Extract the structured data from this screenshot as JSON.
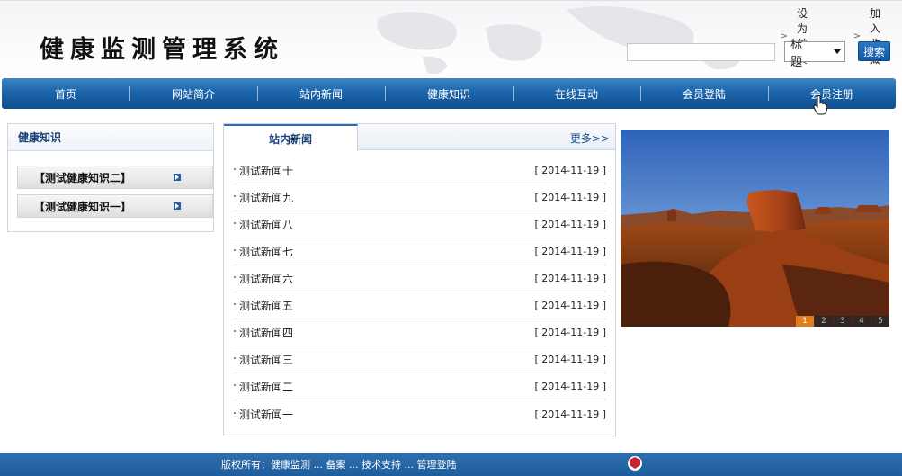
{
  "site": {
    "title": "健康监测管理系统"
  },
  "toplinks": [
    {
      "label": "设为首页"
    },
    {
      "label": "加入收藏"
    }
  ],
  "search": {
    "value": "",
    "select_value": "标 题",
    "button_label": "搜索"
  },
  "nav": [
    {
      "label": "首页"
    },
    {
      "label": "网站简介"
    },
    {
      "label": "站内新闻"
    },
    {
      "label": "健康知识"
    },
    {
      "label": "在线互动"
    },
    {
      "label": "会员登陆"
    },
    {
      "label": "会员注册"
    }
  ],
  "knowledge": {
    "title": "健康知识",
    "items": [
      {
        "label": "【测试健康知识二】"
      },
      {
        "label": "【测试健康知识一】"
      }
    ]
  },
  "news": {
    "tab_label": "站内新闻",
    "more_label": "更多>>",
    "items": [
      {
        "title": "测试新闻十",
        "date": "[ 2014-11-19 ]"
      },
      {
        "title": "测试新闻九",
        "date": "[ 2014-11-19 ]"
      },
      {
        "title": "测试新闻八",
        "date": "[ 2014-11-19 ]"
      },
      {
        "title": "测试新闻七",
        "date": "[ 2014-11-19 ]"
      },
      {
        "title": "测试新闻六",
        "date": "[ 2014-11-19 ]"
      },
      {
        "title": "测试新闻五",
        "date": "[ 2014-11-19 ]"
      },
      {
        "title": "测试新闻四",
        "date": "[ 2014-11-19 ]"
      },
      {
        "title": "测试新闻三",
        "date": "[ 2014-11-19 ]"
      },
      {
        "title": "测试新闻二",
        "date": "[ 2014-11-19 ]"
      },
      {
        "title": "测试新闻一",
        "date": "[ 2014-11-19 ]"
      }
    ]
  },
  "banner": {
    "slides": [
      "1",
      "2",
      "3",
      "4",
      "5"
    ],
    "active_slide": "1"
  },
  "footer": {
    "text": "版权所有：健康监测 ... 备案 ... 技术支持 ... 管理登陆"
  },
  "colors": {
    "nav": "#1c65ab",
    "accent": "#2b5aa1",
    "active_slide": "#e07d1f"
  }
}
